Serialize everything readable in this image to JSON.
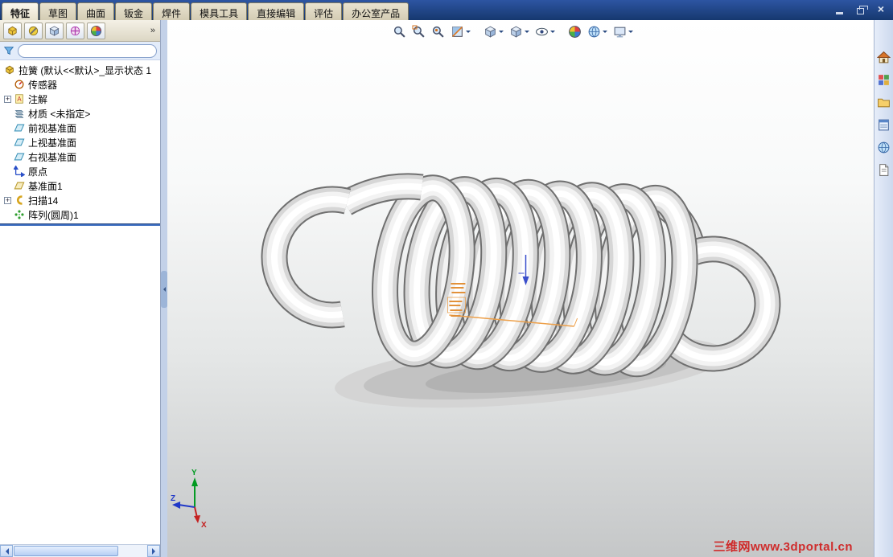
{
  "command_tabs": {
    "active": "特征",
    "items": [
      "特征",
      "草图",
      "曲面",
      "钣金",
      "焊件",
      "模具工具",
      "直接编辑",
      "评估",
      "办公室产品"
    ]
  },
  "window_controls": [
    "minimize-icon",
    "restore-icon",
    "close-icon"
  ],
  "panel": {
    "tab_icons": [
      "featuremanager-tree-icon",
      "propertymanager-icon",
      "configurationmanager-icon",
      "dimxpertmanager-icon",
      "displaymanager-icon"
    ],
    "overflow": "»",
    "filter": {
      "value": "",
      "icon": "filter-funnel-icon"
    },
    "tree": {
      "root": "拉簧 (默认<<默认>_显示状态 1",
      "items": [
        {
          "label": "传感器",
          "expand": "",
          "icon": "sensors-icon"
        },
        {
          "label": "注解",
          "expand": "+",
          "icon": "annotations-icon"
        },
        {
          "label": "材质 <未指定>",
          "expand": "",
          "icon": "material-icon"
        },
        {
          "label": "前视基准面",
          "expand": "",
          "icon": "plane-icon"
        },
        {
          "label": "上视基准面",
          "expand": "",
          "icon": "plane-icon"
        },
        {
          "label": "右视基准面",
          "expand": "",
          "icon": "plane-icon"
        },
        {
          "label": "原点",
          "expand": "",
          "icon": "origin-icon"
        },
        {
          "label": "基准面1",
          "expand": "",
          "icon": "plane1-icon"
        },
        {
          "label": "扫描14",
          "expand": "+",
          "icon": "sweep-icon"
        },
        {
          "label": "阵列(圆周)1",
          "expand": "",
          "icon": "circular-pattern-icon"
        }
      ]
    }
  },
  "hud_icons": [
    "zoom-to-fit",
    "zoom-to-area",
    "zoom-to-selection",
    "section-view",
    "view-orientation",
    "display-style",
    "hide-show-items",
    "edit-appearance",
    "apply-scene",
    "view-settings"
  ],
  "task_pane_icons": [
    "solidworks-resources",
    "design-library",
    "file-explorer",
    "view-palette",
    "appearances-scenes",
    "custom-properties"
  ],
  "viewport": {
    "model": "extension spring (拉簧)",
    "triad": {
      "x": "X",
      "y": "Y",
      "z": "Z"
    },
    "watermark": "三维网www.3dportal.cn"
  },
  "colors": {
    "titlebar_blue": "#1b3e7d",
    "tab_beige": "#e3decb",
    "panel_blue": "#d9e4f4",
    "rollback_blue": "#3f6fc1",
    "watermark_red": "#cf2b2b",
    "sketch_orange": "#e8993f"
  }
}
